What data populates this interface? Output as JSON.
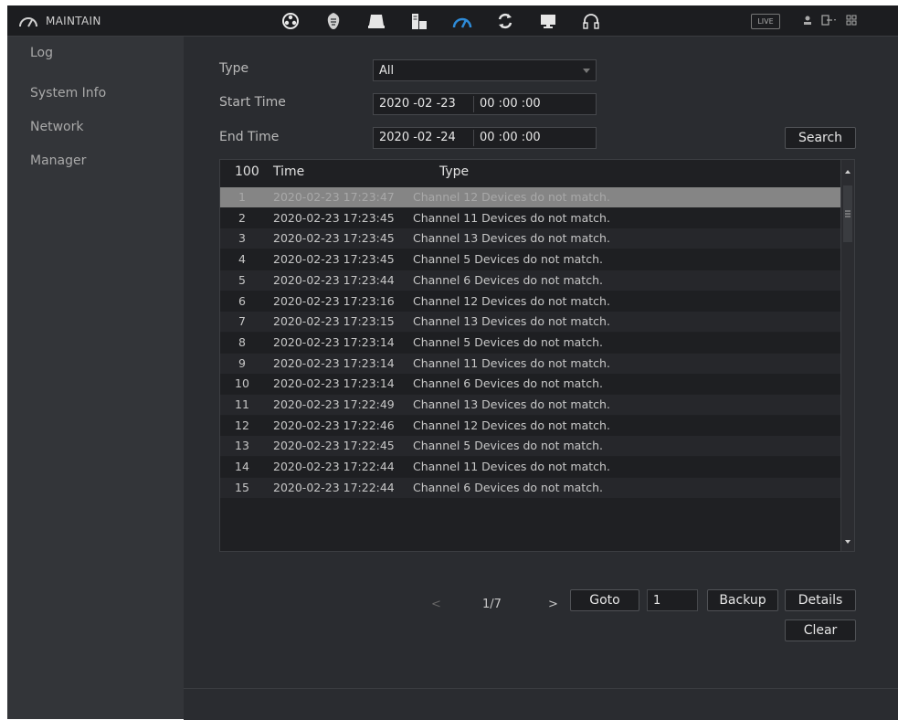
{
  "header": {
    "title": "MAINTAIN",
    "live_label": "LIVE",
    "icons": [
      "search-icon",
      "settings-icon",
      "storage-icon",
      "system-icon",
      "maintain-icon",
      "backup-icon",
      "display-icon",
      "audio-icon"
    ]
  },
  "sidebar": {
    "items": [
      {
        "label": "Log",
        "selected": true
      },
      {
        "label": "System Info"
      },
      {
        "label": "Network"
      },
      {
        "label": "Manager"
      }
    ]
  },
  "filters": {
    "type_label": "Type",
    "type_value": "All",
    "start_label": "Start Time",
    "start_date": "2020 -02 -23",
    "start_time": "00 :00 :00",
    "end_label": "End Time",
    "end_date": "2020 -02 -24",
    "end_time": "00 :00 :00",
    "search_label": "Search"
  },
  "table": {
    "count_header": "100",
    "time_header": "Time",
    "type_header": "Type",
    "rows": [
      {
        "num": "1",
        "time": "2020-02-23 17:23:47",
        "type": "Channel 12 Devices do not match.",
        "selected": true
      },
      {
        "num": "2",
        "time": "2020-02-23 17:23:45",
        "type": "Channel 11 Devices do not match."
      },
      {
        "num": "3",
        "time": "2020-02-23 17:23:45",
        "type": "Channel 13 Devices do not match."
      },
      {
        "num": "4",
        "time": "2020-02-23 17:23:45",
        "type": "Channel 5 Devices do not match."
      },
      {
        "num": "5",
        "time": "2020-02-23 17:23:44",
        "type": "Channel 6 Devices do not match."
      },
      {
        "num": "6",
        "time": "2020-02-23 17:23:16",
        "type": "Channel 12 Devices do not match."
      },
      {
        "num": "7",
        "time": "2020-02-23 17:23:15",
        "type": "Channel 13 Devices do not match."
      },
      {
        "num": "8",
        "time": "2020-02-23 17:23:14",
        "type": "Channel 5 Devices do not match."
      },
      {
        "num": "9",
        "time": "2020-02-23 17:23:14",
        "type": "Channel 11 Devices do not match."
      },
      {
        "num": "10",
        "time": "2020-02-23 17:23:14",
        "type": "Channel 6 Devices do not match."
      },
      {
        "num": "11",
        "time": "2020-02-23 17:22:49",
        "type": "Channel 13 Devices do not match."
      },
      {
        "num": "12",
        "time": "2020-02-23 17:22:46",
        "type": "Channel 12 Devices do not match."
      },
      {
        "num": "13",
        "time": "2020-02-23 17:22:45",
        "type": "Channel 5 Devices do not match."
      },
      {
        "num": "14",
        "time": "2020-02-23 17:22:44",
        "type": "Channel 11 Devices do not match."
      },
      {
        "num": "15",
        "time": "2020-02-23 17:22:44",
        "type": "Channel 6 Devices do not match."
      }
    ]
  },
  "pager": {
    "prev": "<",
    "page": "1/7",
    "next": ">",
    "goto_label": "Goto",
    "goto_value": "1",
    "backup_label": "Backup",
    "details_label": "Details",
    "clear_label": "Clear"
  },
  "colors": {
    "background": "#2a2c30",
    "topbar": "#1c1d20",
    "sidebar": "#333539",
    "active_icon": "#2e8bd8",
    "selected_row": "#858585"
  }
}
